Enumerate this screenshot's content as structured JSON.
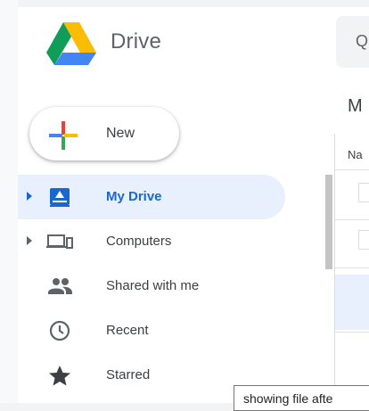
{
  "app": {
    "title": "Drive"
  },
  "header": {
    "search_stub_text": "Q"
  },
  "new_button": {
    "label": "New"
  },
  "nav": {
    "items": [
      {
        "label": "My Drive",
        "icon": "my-drive-icon",
        "active": true,
        "expandable": true
      },
      {
        "label": "Computers",
        "icon": "computers-icon",
        "active": false,
        "expandable": true
      },
      {
        "label": "Shared with me",
        "icon": "shared-with-me-icon",
        "active": false,
        "expandable": false
      },
      {
        "label": "Recent",
        "icon": "clock-icon",
        "active": false,
        "expandable": false
      },
      {
        "label": "Starred",
        "icon": "star-icon",
        "active": false,
        "expandable": false
      }
    ]
  },
  "main": {
    "title_partial": "M",
    "column_header_partial": "Na"
  },
  "tooltip": {
    "text": "showing file afte"
  },
  "colors": {
    "accent": "#1967d2",
    "active_bg": "#e8f0fe",
    "text": "#3c4043",
    "icon": "#5f6368"
  }
}
